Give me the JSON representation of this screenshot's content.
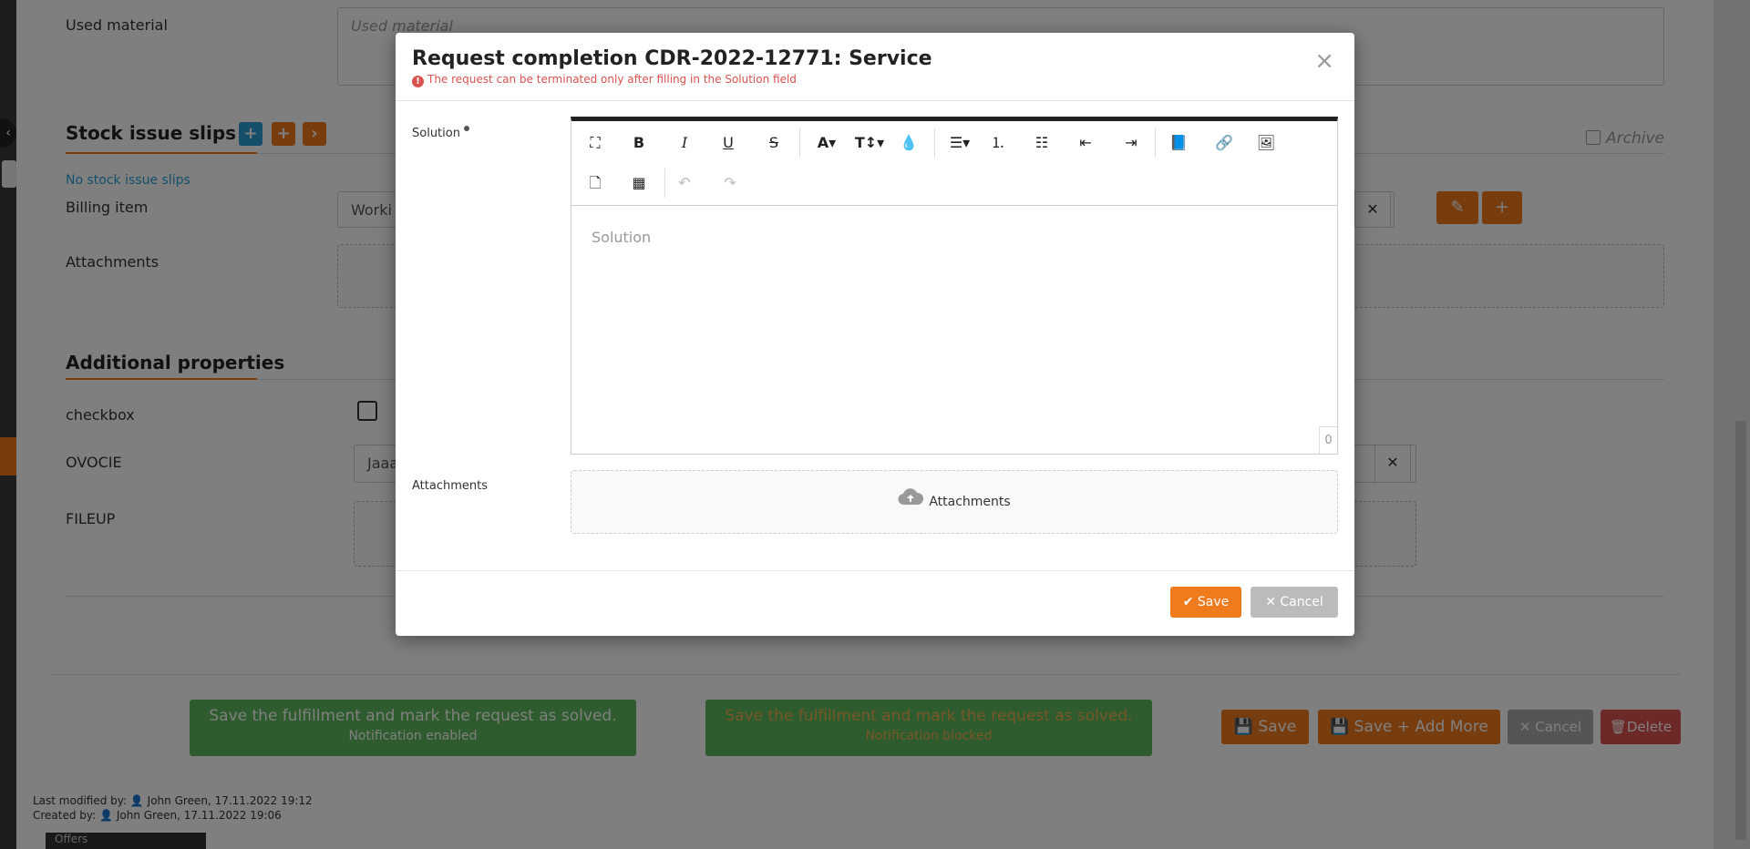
{
  "background": {
    "used_material_label": "Used material",
    "used_material_placeholder": "Used material",
    "stock_issue_slips_title": "Stock issue slips",
    "stock_buttons": [
      "+",
      "+",
      "›"
    ],
    "archive_label": "Archive",
    "no_stock_issue_slips": "No stock issue slips",
    "billing_item_label": "Billing item",
    "billing_item_value": "Worki",
    "attachments_label": "Attachments",
    "additional_properties_title": "Additional properties",
    "checkbox_label": "checkbox",
    "ovocie_label": "OVOCIE",
    "ovocie_value": "Jaaa",
    "fileup_label": "FILEUP",
    "green_buttons": [
      {
        "title": "Save the fulfillment and mark the request as solved.",
        "subtitle": "Notification enabled"
      },
      {
        "title": "Save the fulfillment and mark the request as solved.",
        "subtitle": "Notification blocked"
      }
    ],
    "footer_save": "Save",
    "footer_save_add_more": "Save + Add More",
    "footer_cancel": "Cancel",
    "footer_delete": "Delete",
    "last_modified": "Last modified by:",
    "last_modified_user": "John Green,",
    "last_modified_date": "17.11.2022 19:12",
    "created_by": "Created by:",
    "created_user": "John Green,",
    "created_date": "17.11.2022 19:06",
    "sidebar_item": "Offers"
  },
  "modal": {
    "title": "Request completion CDR-2022-12771: Service",
    "warning": "The request can be terminated only after filling in the Solution field",
    "solution_label": "Solution",
    "solution_placeholder": "Solution",
    "char_count": "0",
    "attachments_label": "Attachments",
    "attachments_dropzone": "Attachments",
    "save_button": "Save",
    "cancel_button": "Cancel"
  },
  "colors": {
    "accent": "#f07b1d",
    "link": "#2a9fd6",
    "success": "#5cb85c",
    "danger": "#d9534f"
  }
}
